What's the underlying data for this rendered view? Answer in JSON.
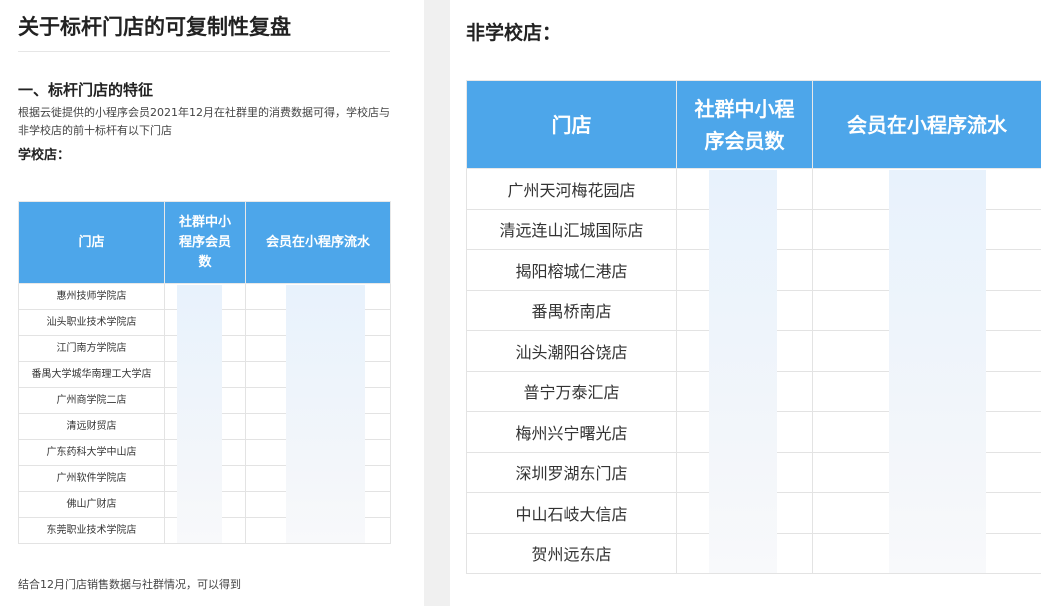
{
  "left": {
    "title": "关于标杆门店的可复制性复盘",
    "section_heading": "一、标杆门店的特征",
    "intro": "根据云徙提供的小程序会员2021年12月在社群里的消费数据可得，学校店与非学校店的前十标杆有以下门店",
    "subheading": "学校店：",
    "table": {
      "headers": [
        "门店",
        "社群中小程序会员数",
        "会员在小程序流水"
      ],
      "rows": [
        "惠州技师学院店",
        "汕头职业技术学院店",
        "江门南方学院店",
        "番禺大学城华南理工大学店",
        "广州商学院二店",
        "清远财贸店",
        "广东药科大学中山店",
        "广州软件学院店",
        "佛山广财店",
        "东莞职业技术学院店"
      ]
    },
    "footnote": "结合12月门店销售数据与社群情况，可以得到"
  },
  "right": {
    "title": "非学校店：",
    "table": {
      "headers": [
        "门店",
        "社群中小程序会员数",
        "会员在小程序流水"
      ],
      "rows": [
        "广州天河梅花园店",
        "清远连山汇城国际店",
        "揭阳榕城仁港店",
        "番禺桥南店",
        "汕头潮阳谷饶店",
        "普宁万泰汇店",
        "梅州兴宁曙光店",
        "深圳罗湖东门店",
        "中山石岐大信店",
        "贺州远东店"
      ]
    }
  },
  "colors": {
    "header_bg": "#4da6ea",
    "header_text": "#ffffff"
  }
}
